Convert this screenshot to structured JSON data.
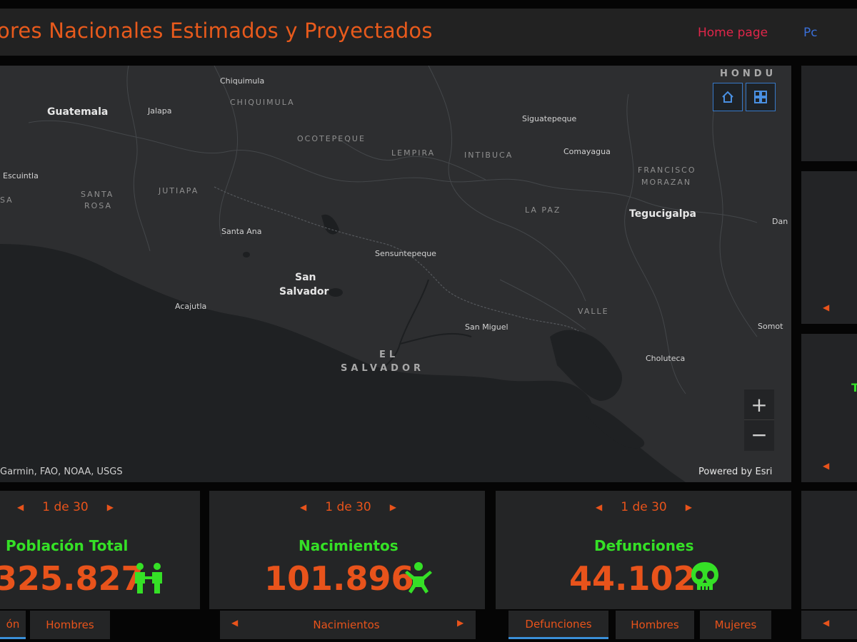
{
  "header": {
    "title": "ores Nacionales Estimados y Proyectados",
    "home_link": "Home page",
    "pc_link": "Pc"
  },
  "map": {
    "labels": {
      "guatemala": "Guatemala",
      "chiquimula": "Chiquimula",
      "chiquimula_dept": "CHIQUIMULA",
      "jalapa": "Jalapa",
      "escuintla": "Escuintla",
      "sa": "SA",
      "santa_rosa_1": "SANTA",
      "santa_rosa_2": "ROSA",
      "jutiapa": "JUTIAPA",
      "ocotepeque": "OCOTEPEQUE",
      "lempira": "LEMPIRA",
      "intibuca": "INTIBUCA",
      "siguatepeque": "Siguatepeque",
      "comayagua": "Comayagua",
      "francisco_1": "FRANCISCO",
      "francisco_2": "MORAZAN",
      "tegucigalpa": "Tegucigalpa",
      "la_paz": "LA PAZ",
      "santa_ana": "Santa Ana",
      "sensuntepeque": "Sensuntepeque",
      "dan": "Dan",
      "san_salvador_1": "San",
      "san_salvador_2": "Salvador",
      "acajutla": "Acajutla",
      "valle": "VALLE",
      "san_miguel": "San Miguel",
      "somoto": "Somot",
      "el": "EL",
      "salvador": "SALVADOR",
      "choluteca": "Choluteca",
      "hondu": "HONDU"
    },
    "attribution": "Garmin, FAO, NOAA, USGS",
    "powered_by": "Powered by Esri",
    "home_icon": "home-icon",
    "basemap_icon": "basemap-gallery-icon",
    "zoom_in": "+",
    "zoom_out": "−"
  },
  "cards": [
    {
      "pager": "1 de 30",
      "label": "Población Total",
      "value": "325.827",
      "icon": "family-icon"
    },
    {
      "pager": "1 de 30",
      "label": "Nacimientos",
      "value": "101.896",
      "icon": "baby-icon"
    },
    {
      "pager": "1 de 30",
      "label": "Defunciones",
      "value": "44.102",
      "icon": "skull-icon"
    }
  ],
  "tabs": {
    "card1": [
      "ón",
      "Hombres"
    ],
    "card2": [
      "Nacimientos"
    ],
    "card3": [
      "Defunciones",
      "Hombres",
      "Mujeres"
    ]
  },
  "side": {
    "letter": "T"
  },
  "colors": {
    "accent_orange": "#e8531b",
    "accent_green": "#35e026",
    "link_red": "#e0264a",
    "link_blue": "#3a6fd8",
    "panel": "#242526",
    "map_land": "#2b2c2e",
    "map_water": "#1e2022"
  }
}
